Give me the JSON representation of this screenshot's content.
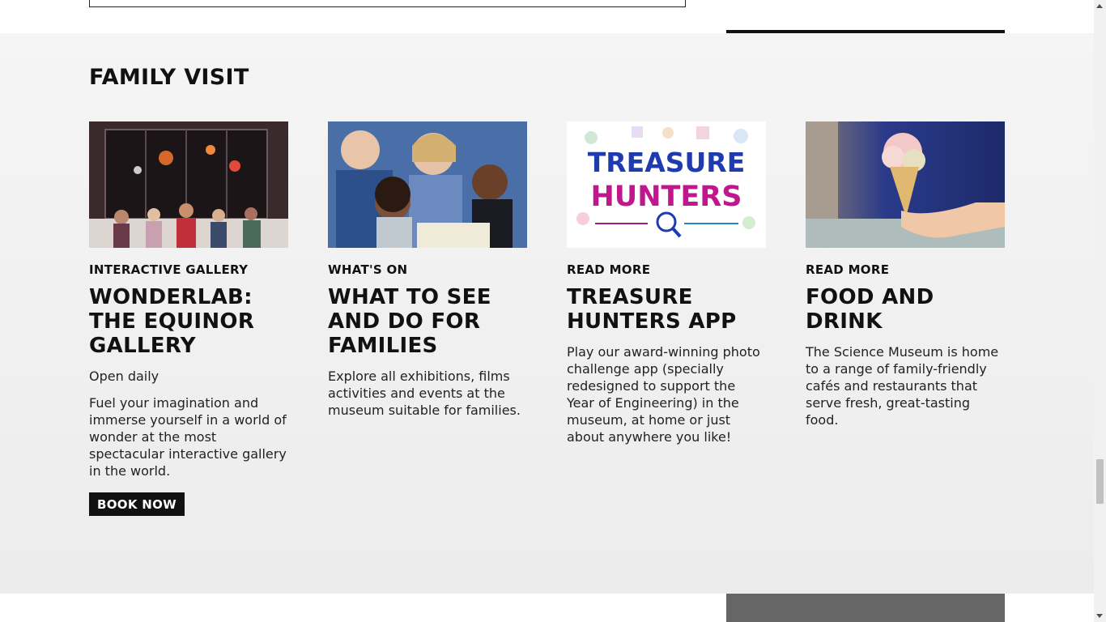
{
  "section": {
    "title": "FAMILY VISIT"
  },
  "cards": [
    {
      "eyebrow": "INTERACTIVE GALLERY",
      "title": "WONDERLAB: THE EQUINOR GALLERY",
      "meta": "Open daily",
      "description": "Fuel your imagination and immerse yourself in a world of wonder at the most spectacular interactive gallery in the world.",
      "button": "BOOK NOW",
      "image_alt": "children-in-wonderlab-gallery"
    },
    {
      "eyebrow": "WHAT'S ON",
      "title": "WHAT TO SEE AND DO FOR FAMILIES",
      "description": "Explore all exhibitions, films activities and events at the museum suitable for families.",
      "image_alt": "grandparents-and-children"
    },
    {
      "eyebrow": "READ MORE",
      "title": "TREASURE HUNTERS APP",
      "description": "Play our award-winning photo challenge app (specially redesigned to support the Year of Engineering) in the museum, at home or just about anywhere you like!",
      "image_text_line1": "TREASURE",
      "image_text_line2": "HUNTERS",
      "image_alt": "treasure-hunters-logo"
    },
    {
      "eyebrow": "READ MORE",
      "title": "FOOD AND DRINK",
      "description": "The Science Museum is home to a range of family-friendly cafés and restaurants that serve fresh, great-tasting food.",
      "image_alt": "ice-cream-cone"
    }
  ],
  "colors": {
    "band": "#f2f2f2",
    "text": "#111111",
    "button_bg": "#111111",
    "button_text": "#ffffff",
    "treasure_blue": "#1f3bb0",
    "treasure_magenta": "#c0188c"
  }
}
